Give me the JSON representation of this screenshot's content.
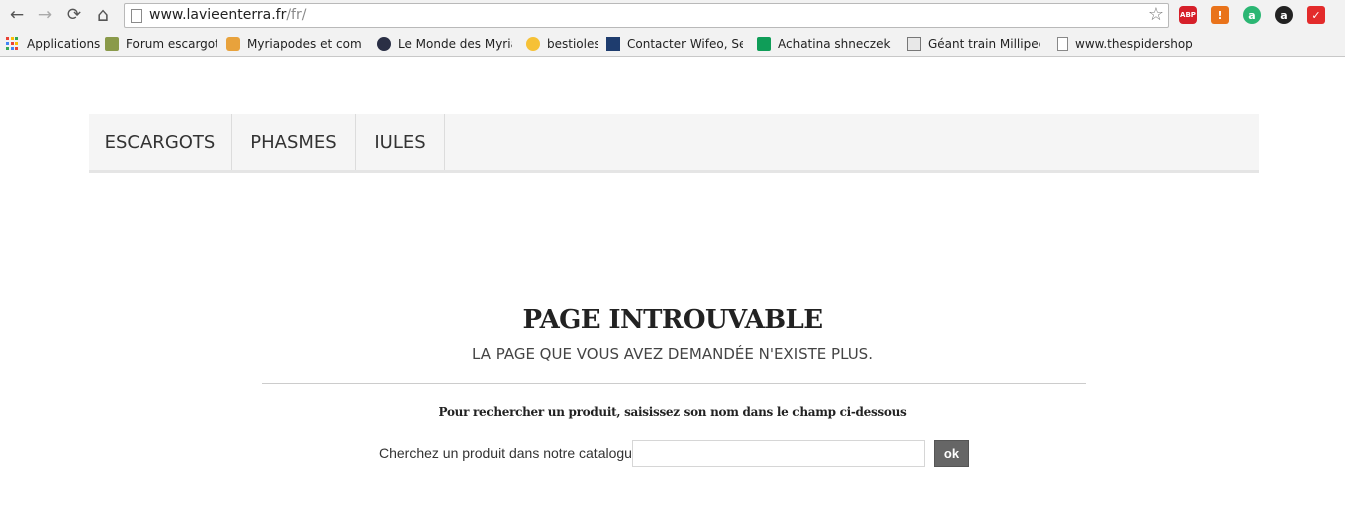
{
  "browser": {
    "url_host": "www.lavieenterra.fr",
    "url_path": "/fr/",
    "nav": {
      "back_icon": "←",
      "forward_icon": "→",
      "reload_icon": "⟳",
      "home_icon": "⌂",
      "star_icon": "☆"
    },
    "extensions": [
      {
        "name": "adblock-plus-icon",
        "glyph": "ABP"
      },
      {
        "name": "alert-extension-icon",
        "glyph": "!"
      },
      {
        "name": "grammarly-icon",
        "glyph": "a"
      },
      {
        "name": "a-extension-icon",
        "glyph": "a"
      },
      {
        "name": "red-extension-icon",
        "glyph": "✓"
      }
    ]
  },
  "bookmarks": [
    {
      "label": "Applications"
    },
    {
      "label": "Forum escargots"
    },
    {
      "label": "Myriapodes et compa"
    },
    {
      "label": "Le Monde des Myriap"
    },
    {
      "label": "bestioles"
    },
    {
      "label": "Contacter Wifeo, Serv"
    },
    {
      "label": "Achatina shneczek - P"
    },
    {
      "label": "Géant train Millipede"
    },
    {
      "label": "www.thespidershop.co"
    }
  ],
  "site_menu": {
    "items": [
      {
        "label": "ESCARGOTS"
      },
      {
        "label": "PHASMES"
      },
      {
        "label": "IULES"
      }
    ]
  },
  "content": {
    "title": "PAGE INTROUVABLE",
    "subtitle": "LA PAGE QUE VOUS AVEZ DEMANDÉE N'EXISTE PLUS.",
    "search_hint": "Pour rechercher un produit, saisissez son nom dans le champ ci-dessous",
    "search_label": "Cherchez un produit dans notre catalogue :",
    "search_value": "",
    "search_placeholder": "",
    "search_button": "ok"
  }
}
